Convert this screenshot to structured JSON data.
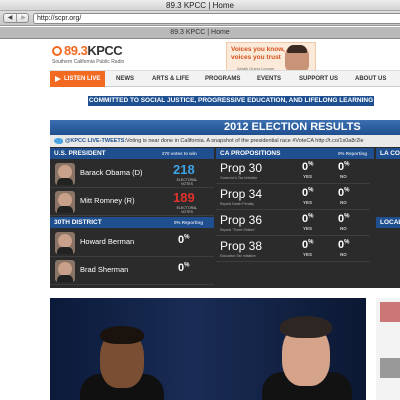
{
  "window": {
    "title": "89.3 KPCC | Home"
  },
  "toolbar": {
    "back": "◀",
    "forward": "▶",
    "url": "http://scpr.org/"
  },
  "tab": {
    "title": "89.3 KPCC | Home"
  },
  "site": {
    "logo": {
      "freq": "89.3",
      "name": "KPCC",
      "tagline": "Southern California Public Radio"
    },
    "ad": {
      "line1": "Voices you know,",
      "line2": "voices you trust",
      "credit": "Airtalk Guest Lounge"
    },
    "nav": {
      "listen": "LISTEN LIVE",
      "items": [
        "NEWS",
        "ARTS & LIFE",
        "PROGRAMS",
        "EVENTS",
        "SUPPORT US",
        "ABOUT US"
      ]
    },
    "banner": "COMMITTED TO SOCIAL JUSTICE, PROGRESSIVE EDUCATION, AND LIFELONG LEARNING"
  },
  "election": {
    "title": "2012 ELECTION RESULTS",
    "tweet_label": "@KPCC LIVE-TWEETS:",
    "tweet_text": "Voting is near done in California. A snapshot of the presidential race #VoteCA http://t.co/1s0a8r2le",
    "president": {
      "heading": "U.S. PRESIDENT",
      "sub": "270 votes to win",
      "candidates": [
        {
          "name": "Barack Obama (D)",
          "votes": "218",
          "label": "ELECTORAL VOTES",
          "color": "#3ea2e6"
        },
        {
          "name": "Mitt Romney (R)",
          "votes": "189",
          "label": "ELECTORAL VOTES",
          "color": "#e0322d"
        }
      ]
    },
    "district": {
      "heading": "30TH DISTRICT",
      "sub": "0% Reporting",
      "candidates": [
        {
          "name": "Howard Berman",
          "pct": "0",
          "unit": "%"
        },
        {
          "name": "Brad Sherman",
          "pct": "0",
          "unit": "%"
        }
      ]
    },
    "props": {
      "heading": "CA PROPOSITIONS",
      "sub": "0% Reporting",
      "yes": "YES",
      "no": "NO",
      "items": [
        {
          "name": "Prop 30",
          "desc": "Governor's Tax Initiative",
          "yes": "0",
          "no": "0",
          "unit": "%"
        },
        {
          "name": "Prop 34",
          "desc": "Repeal Death Penalty",
          "yes": "0",
          "no": "0",
          "unit": "%"
        },
        {
          "name": "Prop 36",
          "desc": "Repeal \"Three Strikes\"",
          "yes": "0",
          "no": "0",
          "unit": "%"
        },
        {
          "name": "Prop 38",
          "desc": "Education Tax Initiative",
          "yes": "0",
          "no": "0",
          "unit": "%"
        }
      ]
    },
    "la": {
      "heading": "LA CO",
      "local": "LOCAL"
    }
  }
}
